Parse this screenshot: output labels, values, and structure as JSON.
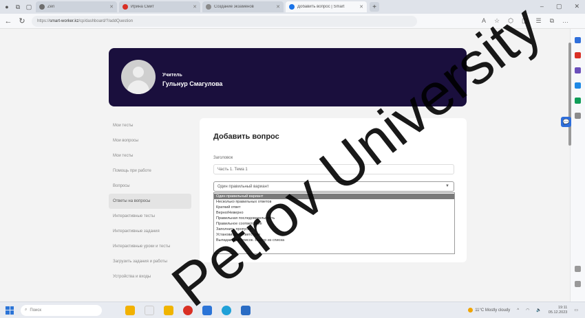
{
  "browser": {
    "tabs": [
      {
        "label": "Zen",
        "active": false,
        "fav_color": "#6d6d6d"
      },
      {
        "label": "Ирина Смит",
        "active": false,
        "fav_color": "#d93025"
      },
      {
        "label": "Создание экзаменов",
        "active": false,
        "fav_color": "#8a8a8a"
      },
      {
        "label": "Добавить вопрос | Smart",
        "active": true,
        "fav_color": "#1a73e8"
      }
    ],
    "url_scheme": "https://",
    "url_host": "smart-worker.kz",
    "url_path": "/cp/dashboard/?/addQuestion"
  },
  "header": {
    "role": "Учитель",
    "teacher_name": "Гульнур Смагулова"
  },
  "sidebar": {
    "items": [
      {
        "label": "Мои тесты",
        "active": false
      },
      {
        "label": "Мои вопросы",
        "active": false
      },
      {
        "label": "Мои тесты",
        "active": false
      },
      {
        "label": "Помощь при работе",
        "active": false
      },
      {
        "label": "Вопросы",
        "active": false
      },
      {
        "label": "Ответы на вопросы",
        "active": true
      },
      {
        "label": "Интерактивные тесты",
        "active": false
      },
      {
        "label": "Интерактивные задания",
        "active": false
      },
      {
        "label": "Интерактивные уроки и тесты",
        "active": false
      },
      {
        "label": "Загрузить задания и работы",
        "active": false
      },
      {
        "label": "Устройства и входы",
        "active": false
      }
    ]
  },
  "form": {
    "title": "Добавить вопрос",
    "field_label": "Заголовок",
    "title_value": "Часть 1. Тема 1",
    "select_value": "Один правильный вариант",
    "options": [
      "Один правильный вариант",
      "Несколько правильных ответов",
      "Краткий ответ",
      "Верно/Неверно",
      "Правильная последовательность",
      "Правильное соответствие",
      "Заполнить пропуски",
      "Установить соответствие",
      "Выпадающий список. Выбор из списка"
    ],
    "highlighted_index": 0
  },
  "taskbar": {
    "search_placeholder": "Поиск",
    "weather": "11°C Mostly cloudy",
    "time": "19:11",
    "date": "05.12.2023"
  },
  "watermark": "Petrov University",
  "colors": {
    "header_bg": "#1a0f3d",
    "accent": "#2f6fdb",
    "page_bg": "#f3f3f3",
    "highlight": "#7a7a7a"
  }
}
